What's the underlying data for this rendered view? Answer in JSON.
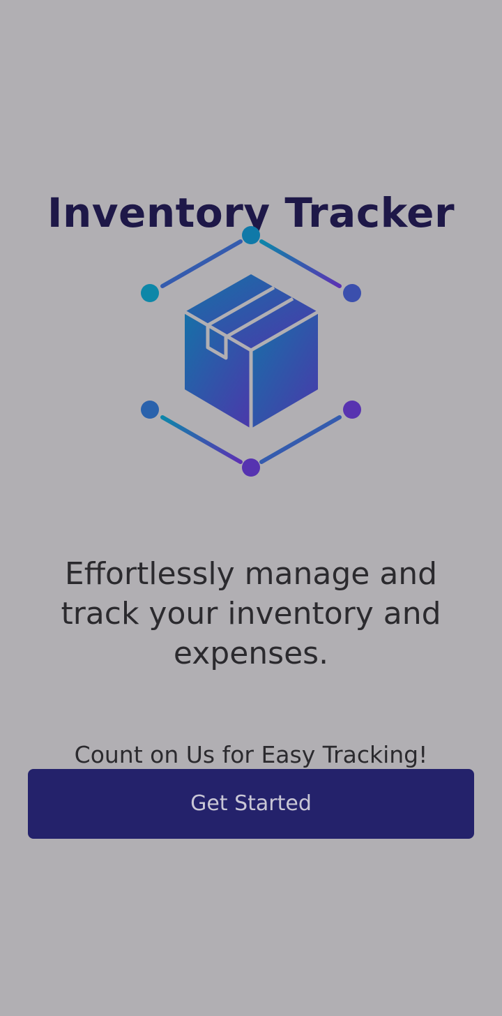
{
  "header": {
    "title": "Inventory Tracker"
  },
  "logo": {
    "icon": "package-box-network-icon",
    "gradient_start": "#0f7fa7",
    "gradient_end": "#5a36b2"
  },
  "content": {
    "tagline": "Effortlessly manage and track your inventory and expenses.",
    "subline": "Count on Us for Easy Tracking!"
  },
  "actions": {
    "get_started_label": "Get Started"
  },
  "theme": {
    "background": "#b1afb3",
    "primary": "#24226b",
    "title_color": "#1e1848"
  }
}
